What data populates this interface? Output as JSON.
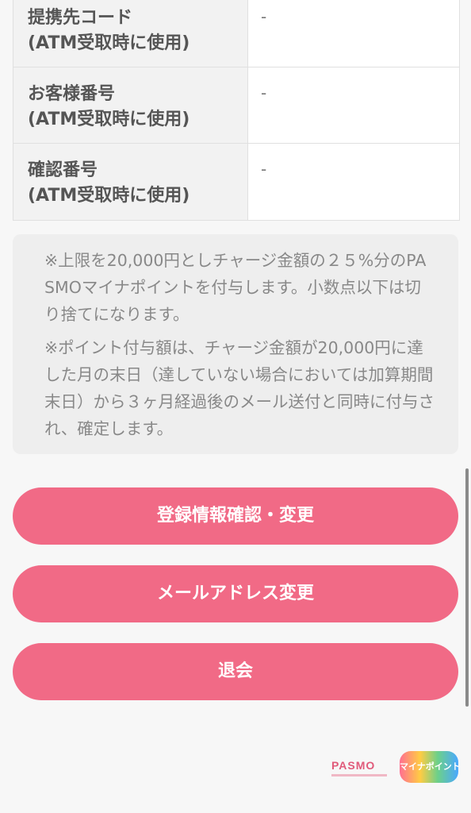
{
  "table": {
    "rows": [
      {
        "label_main": "提携先コード",
        "label_sub": "(ATM受取時に使用)",
        "value": "-"
      },
      {
        "label_main": "お客様番号",
        "label_sub": "(ATM受取時に使用)",
        "value": "-"
      },
      {
        "label_main": "確認番号",
        "label_sub": "(ATM受取時に使用)",
        "value": "-"
      }
    ]
  },
  "notice": {
    "paragraph_1": "※上限を20,000円としチャージ金額の２５%分のPASMOマイナポイントを付与します。小数点以下は切り捨てになります。",
    "paragraph_2": "※ポイント付与額は、チャージ金額が20,000円に達した月の末日（達していない場合においては加算期間末日）から３ヶ月経過後のメール送付と同時に付与され、確定します。"
  },
  "buttons": {
    "registration": "登録情報確認・変更",
    "email_change": "メールアドレス変更",
    "withdraw": "退会"
  },
  "logos": {
    "pasmo": "PASMO",
    "mynapoint": "マイナポイント"
  },
  "colors": {
    "button": "#f16a86",
    "notice_bg": "#eeeeee",
    "table_label_bg": "#f2f2f2"
  }
}
